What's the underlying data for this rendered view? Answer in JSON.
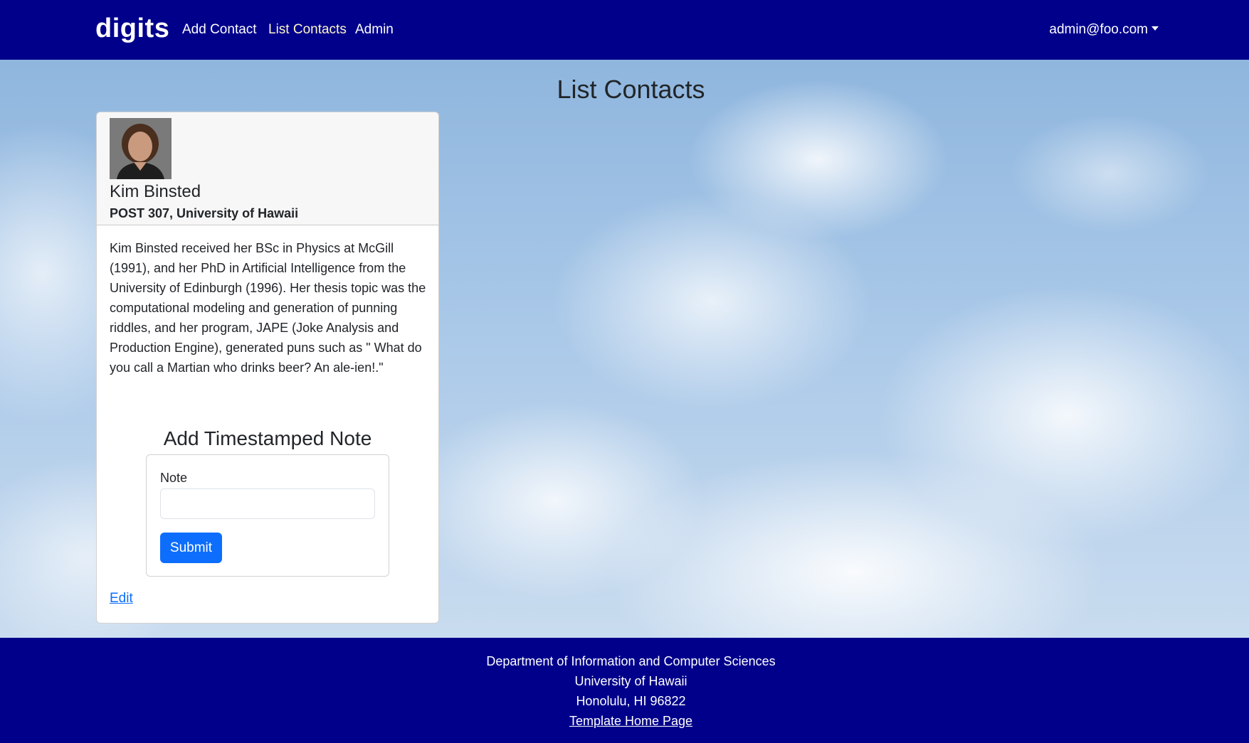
{
  "navbar": {
    "brand": "digits",
    "links": [
      {
        "label": "Add Contact"
      },
      {
        "label": "List Contacts",
        "active": true
      },
      {
        "label": "Admin"
      }
    ],
    "user": "admin@foo.com",
    "background_color": "#00008b"
  },
  "page": {
    "title": "List Contacts"
  },
  "contact": {
    "name": "Kim Binsted",
    "address": "POST 307, University of Hawaii",
    "bio": "Kim Binsted received her BSc in Physics at McGill (1991), and her PhD in Artificial Intelligence from the University of Edinburgh (1996). Her thesis topic was the computational modeling and generation of punning riddles, and her program, JAPE (Joke Analysis and Production Engine), generated puns such as \" What do you call a Martian who drinks beer? An ale-ien!.\"",
    "edit_label": "Edit"
  },
  "note_form": {
    "title": "Add Timestamped Note",
    "label": "Note",
    "value": "",
    "submit_label": "Submit",
    "button_color": "#0d6efd"
  },
  "footer": {
    "lines": [
      "Department of Information and Computer Sciences",
      "University of Hawaii",
      "Honolulu, HI 96822"
    ],
    "link_label": "Template Home Page"
  }
}
